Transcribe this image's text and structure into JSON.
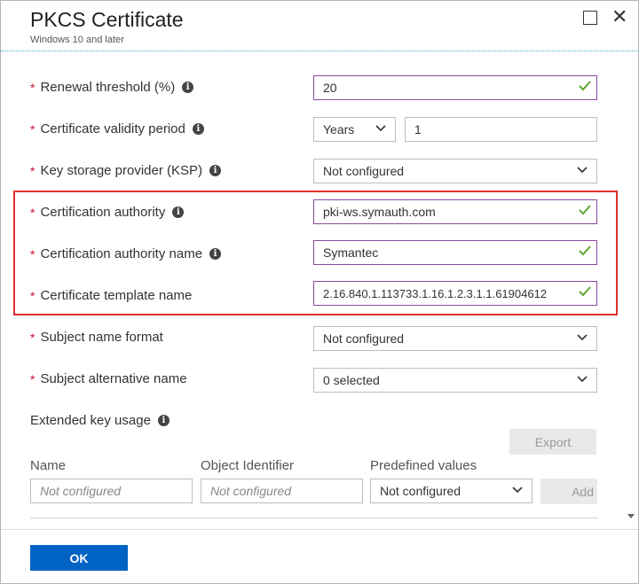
{
  "header": {
    "title": "PKCS Certificate",
    "subtitle": "Windows 10 and later"
  },
  "form": {
    "renewal_threshold": {
      "label": "Renewal threshold (%)",
      "value": "20"
    },
    "validity_period": {
      "label": "Certificate validity period",
      "unit": "Years",
      "value": "1"
    },
    "ksp": {
      "label": "Key storage provider (KSP)",
      "value": "Not configured"
    },
    "cert_authority": {
      "label": "Certification authority",
      "value": "pki-ws.symauth.com"
    },
    "cert_authority_name": {
      "label": "Certification authority name",
      "value": "Symantec"
    },
    "cert_template_name": {
      "label": "Certificate template name",
      "value": "2.16.840.1.113733.1.16.1.2.3.1.1.61904612"
    },
    "subject_name_format": {
      "label": "Subject name format",
      "value": "Not configured"
    },
    "subject_alt_name": {
      "label": "Subject alternative name",
      "value": "0 selected"
    }
  },
  "eku": {
    "label": "Extended key usage",
    "export_label": "Export",
    "columns": {
      "name": "Name",
      "oid": "Object Identifier",
      "predefined": "Predefined values"
    },
    "name_placeholder": "Not configured",
    "oid_placeholder": "Not configured",
    "predefined_value": "Not configured",
    "add_label": "Add"
  },
  "footer": {
    "ok_label": "OK"
  },
  "colors": {
    "accent": "#0063c3",
    "valid_border": "#8c4aa0",
    "check": "#5ea830",
    "required": "#c8102e",
    "highlight_box": "#e03030"
  }
}
